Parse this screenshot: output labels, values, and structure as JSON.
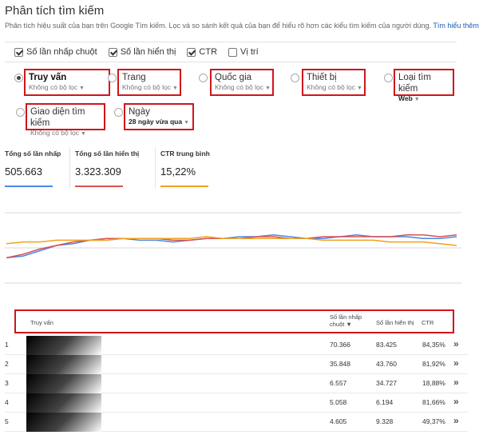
{
  "header": {
    "title": "Phân tích tìm kiếm",
    "subtitle": "Phân tích hiệu suất của bạn trên Google Tìm kiếm. Lọc và so sánh kết quả của bạn để hiểu rõ hơn các kiểu tìm kiếm của người dùng.",
    "learn_more": "Tìm hiểu thêm."
  },
  "metrics": [
    {
      "label": "Số lần nhấp chuột",
      "checked": true
    },
    {
      "label": "Số lần hiển thị",
      "checked": true
    },
    {
      "label": "CTR",
      "checked": true
    },
    {
      "label": "Vị trí",
      "checked": false
    }
  ],
  "dimensions": [
    {
      "label": "Truy vấn",
      "filter": "Không có bộ lọc",
      "selected": true
    },
    {
      "label": "Trang",
      "filter": "Không có bộ lọc",
      "selected": false
    },
    {
      "label": "Quốc gia",
      "filter": "Không có bộ lọc",
      "selected": false
    },
    {
      "label": "Thiết bị",
      "filter": "Không có bộ lọc",
      "selected": false
    },
    {
      "label": "Loại tìm kiếm",
      "filter": "Web",
      "selected": false
    },
    {
      "label": "Giao diện tìm kiếm",
      "filter": "Không có bộ lọc",
      "selected": false
    },
    {
      "label": "Ngày",
      "filter": "28 ngày vừa qua",
      "selected": false
    }
  ],
  "totals": [
    {
      "label": "Tổng số lần nhấp",
      "value": "505.663",
      "color": "#4a86e8"
    },
    {
      "label": "Tổng số lần hiển thị",
      "value": "3.323.309",
      "color": "#d9534f"
    },
    {
      "label": "CTR trung bình",
      "value": "15,22%",
      "color": "#f0a020"
    }
  ],
  "chart_data": {
    "type": "line",
    "x": [
      1,
      2,
      3,
      4,
      5,
      6,
      7,
      8,
      9,
      10,
      11,
      12,
      13,
      14,
      15,
      16,
      17,
      18,
      19,
      20,
      21,
      22,
      23,
      24,
      25,
      26,
      27,
      28
    ],
    "series": [
      {
        "color": "#4a86e8",
        "values": [
          18,
          19,
          22,
          25,
          26,
          28,
          28,
          29,
          28,
          28,
          27,
          28,
          29,
          29,
          30,
          30,
          31,
          30,
          29,
          29,
          30,
          31,
          30,
          30,
          30,
          29,
          29,
          30
        ]
      },
      {
        "color": "#d9534f",
        "values": [
          18,
          20,
          23,
          25,
          27,
          28,
          29,
          29,
          29,
          29,
          28,
          28,
          29,
          29,
          29,
          30,
          30,
          29,
          29,
          30,
          30,
          30,
          30,
          30,
          31,
          31,
          30,
          31
        ]
      },
      {
        "color": "#f0a020",
        "values": [
          26,
          27,
          27,
          28,
          28,
          28,
          28,
          29,
          29,
          29,
          29,
          29,
          30,
          29,
          29,
          29,
          29,
          29,
          29,
          28,
          28,
          28,
          28,
          27,
          27,
          27,
          26,
          25
        ]
      }
    ],
    "grid": true
  },
  "table": {
    "headers": {
      "query": "Truy vấn",
      "clicks": "Số lần nhấp chuột ▼",
      "impressions": "Số lần hiển thị",
      "ctr": "CTR"
    },
    "rows": [
      {
        "n": "1",
        "clicks": "70.366",
        "impressions": "83.425",
        "ctr": "84,35%"
      },
      {
        "n": "2",
        "clicks": "35.848",
        "impressions": "43.760",
        "ctr": "81,92%"
      },
      {
        "n": "3",
        "clicks": "6.557",
        "impressions": "34.727",
        "ctr": "18,88%"
      },
      {
        "n": "4",
        "clicks": "5.058",
        "impressions": "6.194",
        "ctr": "81,66%"
      },
      {
        "n": "5",
        "clicks": "4.605",
        "impressions": "9.328",
        "ctr": "49,37%"
      }
    ],
    "row_action_icon": "double-chevron-right-icon"
  }
}
